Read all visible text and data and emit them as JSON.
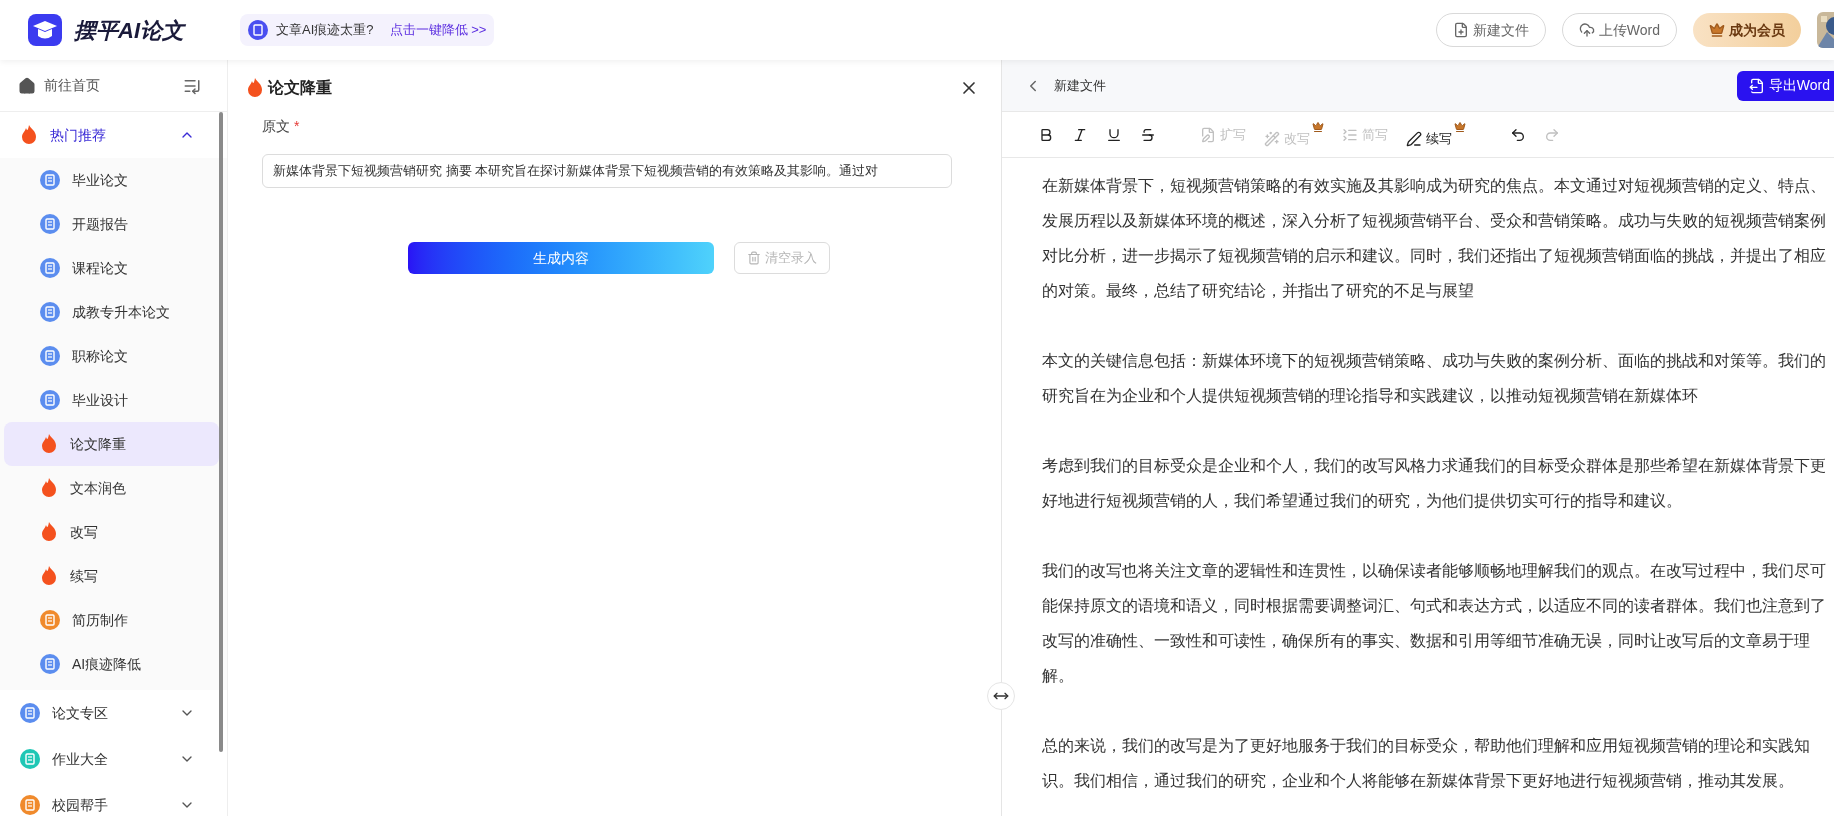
{
  "header": {
    "logo": "摆平AI论文",
    "notice": {
      "text": "文章AI痕迹太重?",
      "link": "点击一键降低 >>"
    },
    "actions": [
      {
        "label": "新建文件",
        "kind": "new"
      },
      {
        "label": "上传Word",
        "kind": "upload"
      },
      {
        "label": "成为会员",
        "kind": "vip"
      }
    ]
  },
  "sidebar": {
    "home": "前往首页",
    "groups": [
      {
        "label": "热门推荐",
        "kind": "fire",
        "expanded": true,
        "children": [
          {
            "label": "毕业论文",
            "kind": "doc",
            "selected": false
          },
          {
            "label": "开题报告",
            "kind": "doc",
            "selected": false
          },
          {
            "label": "课程论文",
            "kind": "doc",
            "selected": false
          },
          {
            "label": "成教专升本论文",
            "kind": "doc",
            "selected": false
          },
          {
            "label": "职称论文",
            "kind": "doc",
            "selected": false
          },
          {
            "label": "毕业设计",
            "kind": "doc",
            "selected": false
          },
          {
            "label": "论文降重",
            "kind": "fire",
            "selected": true
          },
          {
            "label": "文本润色",
            "kind": "fire",
            "selected": false
          },
          {
            "label": "改写",
            "kind": "fire",
            "selected": false
          },
          {
            "label": "续写",
            "kind": "fire",
            "selected": false
          },
          {
            "label": "简历制作",
            "kind": "resume",
            "selected": false
          },
          {
            "label": "AI痕迹降低",
            "kind": "doc",
            "selected": false
          }
        ]
      },
      {
        "label": "论文专区",
        "kind": "doc",
        "expanded": false
      },
      {
        "label": "作业大全",
        "kind": "book",
        "expanded": false
      },
      {
        "label": "校园帮手",
        "kind": "resume",
        "expanded": false
      }
    ]
  },
  "tool_panel": {
    "title": "论文降重",
    "field_label": "原文",
    "required_mark": "*",
    "field_value": "新媒体背景下短视频营销研究 摘要 本研究旨在探讨新媒体背景下短视频营销的有效策略及其影响。通过对",
    "buttons": [
      {
        "label": "生成内容",
        "kind": "primary",
        "disabled": false
      },
      {
        "label": "清空录入",
        "kind": "clear",
        "disabled": true
      }
    ]
  },
  "editor": {
    "title": "新建文件",
    "export": "导出Word",
    "toolbar": [
      {
        "kind": "bold",
        "disabled": false
      },
      {
        "kind": "italic",
        "disabled": false
      },
      {
        "kind": "underline",
        "disabled": false
      },
      {
        "kind": "strike",
        "disabled": false
      },
      {
        "kind": "expand",
        "label": "扩写",
        "disabled": true,
        "premium": false
      },
      {
        "kind": "rewrite",
        "label": "改写",
        "disabled": true,
        "premium": true
      },
      {
        "kind": "shorten",
        "label": "简写",
        "disabled": true,
        "premium": false
      },
      {
        "kind": "continue",
        "label": "续写",
        "disabled": false,
        "premium": true
      },
      {
        "kind": "undo",
        "disabled": false
      },
      {
        "kind": "redo",
        "disabled": true
      }
    ],
    "paragraphs": [
      "在新媒体背景下，短视频营销策略的有效实施及其影响成为研究的焦点。本文通过对短视频营销的定义、特点、发展历程以及新媒体环境的概述，深入分析了短视频营销平台、受众和营销策略。成功与失败的短视频营销案例对比分析，进一步揭示了短视频营销的启示和建议。同时，我们还指出了短视频营销面临的挑战，并提出了相应的对策。最终，总结了研究结论，并指出了研究的不足与展望",
      "本文的关键信息包括：新媒体环境下的短视频营销策略、成功与失败的案例分析、面临的挑战和对策等。我们的研究旨在为企业和个人提供短视频营销的理论指导和实践建议，以推动短视频营销在新媒体环",
      "考虑到我们的目标受众是企业和个人，我们的改写风格力求通我们的目标受众群体是那些希望在新媒体背景下更好地进行短视频营销的人，我们希望通过我们的研究，为他们提供切实可行的指导和建议。",
      "我们的改写也将关注文章的逻辑性和连贯性，以确保读者能够顺畅地理解我们的观点。在改写过程中，我们尽可能保持原文的语境和语义，同时根据需要调整词汇、句式和表达方式，以适应不同的读者群体。我们也注意到了改写的准确性、一致性和可读性，确保所有的事实、数据和引用等细节准确无误，同时让改写后的文章易于理解。",
      "总的来说，我们的改写是为了更好地服务于我们的目标受众，帮助他们理解和应用短视频营销的理论和实践知识。我们相信，通过我们的研究，企业和个人将能够在新媒体背景下更好地进行短视频营销，推动其发展。"
    ]
  }
}
